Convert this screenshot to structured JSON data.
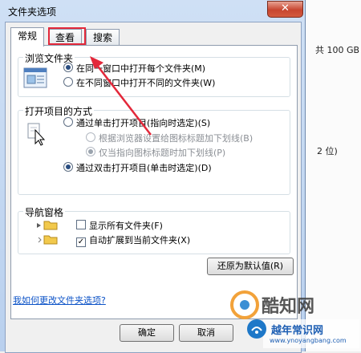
{
  "dialog": {
    "title": "文件夹选项",
    "close_glyph": "✕",
    "tabs": [
      "常规",
      "查看",
      "搜索"
    ],
    "browse_group": {
      "title": "浏览文件夹",
      "options": [
        "在同一窗口中打开每个文件夹(M)",
        "在不同窗口中打开不同的文件夹(W)"
      ],
      "selected": 0
    },
    "open_group": {
      "title": "打开项目的方式",
      "single_click": "通过单击打开项目(指向时选定)(S)",
      "underline_browser": "根据浏览器设置给图标标题加下划线(B)",
      "underline_hover": "仅当指向图标标题时加下划线(P)",
      "double_click": "通过双击打开项目(单击时选定)(D)"
    },
    "nav_group": {
      "title": "导航窗格",
      "show_all": "显示所有文件夹(F)",
      "auto_expand": "自动扩展到当前文件夹(X)",
      "check_mark": "✓"
    },
    "restore_button": "还原为默认值(R)",
    "help_link": "我如何更改文件夹选项?",
    "ok_button": "确定",
    "cancel_button": "取消"
  },
  "background": {
    "disk_text": "共 100 GB",
    "bits_text": "2 位)"
  },
  "watermarks": {
    "brand1": "酷知网",
    "brand2": "越年常识网",
    "url": "www.ynoyangbang.com"
  },
  "colors": {
    "highlight": "#e3283a",
    "link": "#0b52c7"
  }
}
